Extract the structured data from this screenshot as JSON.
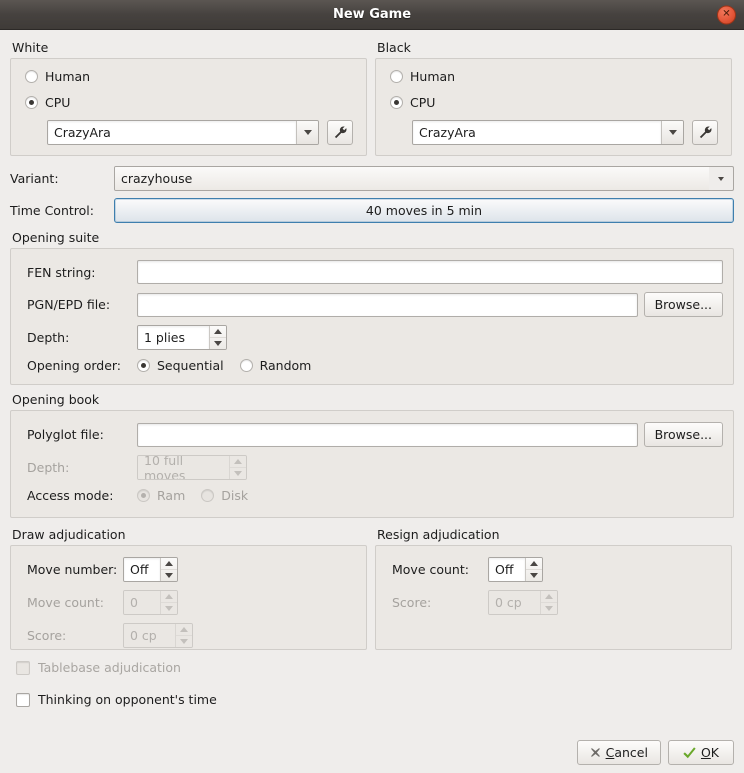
{
  "window": {
    "title": "New Game",
    "close_icon": "close-icon"
  },
  "white": {
    "group_label": "White",
    "human_label": "Human",
    "cpu_label": "CPU",
    "engine_value": "CrazyAra",
    "config_icon": "wrench-icon"
  },
  "black": {
    "group_label": "Black",
    "human_label": "Human",
    "cpu_label": "CPU",
    "engine_value": "CrazyAra",
    "config_icon": "wrench-icon"
  },
  "variant": {
    "label": "Variant:",
    "value": "crazyhouse"
  },
  "time_control": {
    "label": "Time Control:",
    "value": "40 moves in 5 min"
  },
  "opening_suite": {
    "group_label": "Opening suite",
    "fen_label": "FEN string:",
    "fen_value": "",
    "pgn_label": "PGN/EPD file:",
    "pgn_value": "",
    "pgn_browse_label": "Browse...",
    "depth_label": "Depth:",
    "depth_value": "1 plies",
    "order_label": "Opening order:",
    "order_sequential": "Sequential",
    "order_random": "Random"
  },
  "opening_book": {
    "group_label": "Opening book",
    "polyglot_label": "Polyglot file:",
    "polyglot_value": "",
    "polyglot_browse_label": "Browse...",
    "depth_label": "Depth:",
    "depth_value": "10 full moves",
    "access_label": "Access mode:",
    "access_ram": "Ram",
    "access_disk": "Disk"
  },
  "draw_adjudication": {
    "group_label": "Draw adjudication",
    "move_number_label": "Move number:",
    "move_number_value": "Off",
    "move_count_label": "Move count:",
    "move_count_value": "0",
    "score_label": "Score:",
    "score_value": "0 cp"
  },
  "resign_adjudication": {
    "group_label": "Resign adjudication",
    "move_count_label": "Move count:",
    "move_count_value": "Off",
    "score_label": "Score:",
    "score_value": "0 cp"
  },
  "options": {
    "tablebase_label": "Tablebase adjudication",
    "thinking_label": "Thinking on opponent's time"
  },
  "footer": {
    "cancel_label": "Cancel",
    "cancel_accel": "C",
    "ok_label": "OK",
    "ok_accel": "O"
  },
  "colors": {
    "window_bg": "#efedeb",
    "groupbox_bg": "#ebe8e4",
    "titlebar_bg": "#46423f",
    "close_button": "#e4573a",
    "focus_border": "#3e7fae",
    "ok_check": "#6aa82b"
  }
}
